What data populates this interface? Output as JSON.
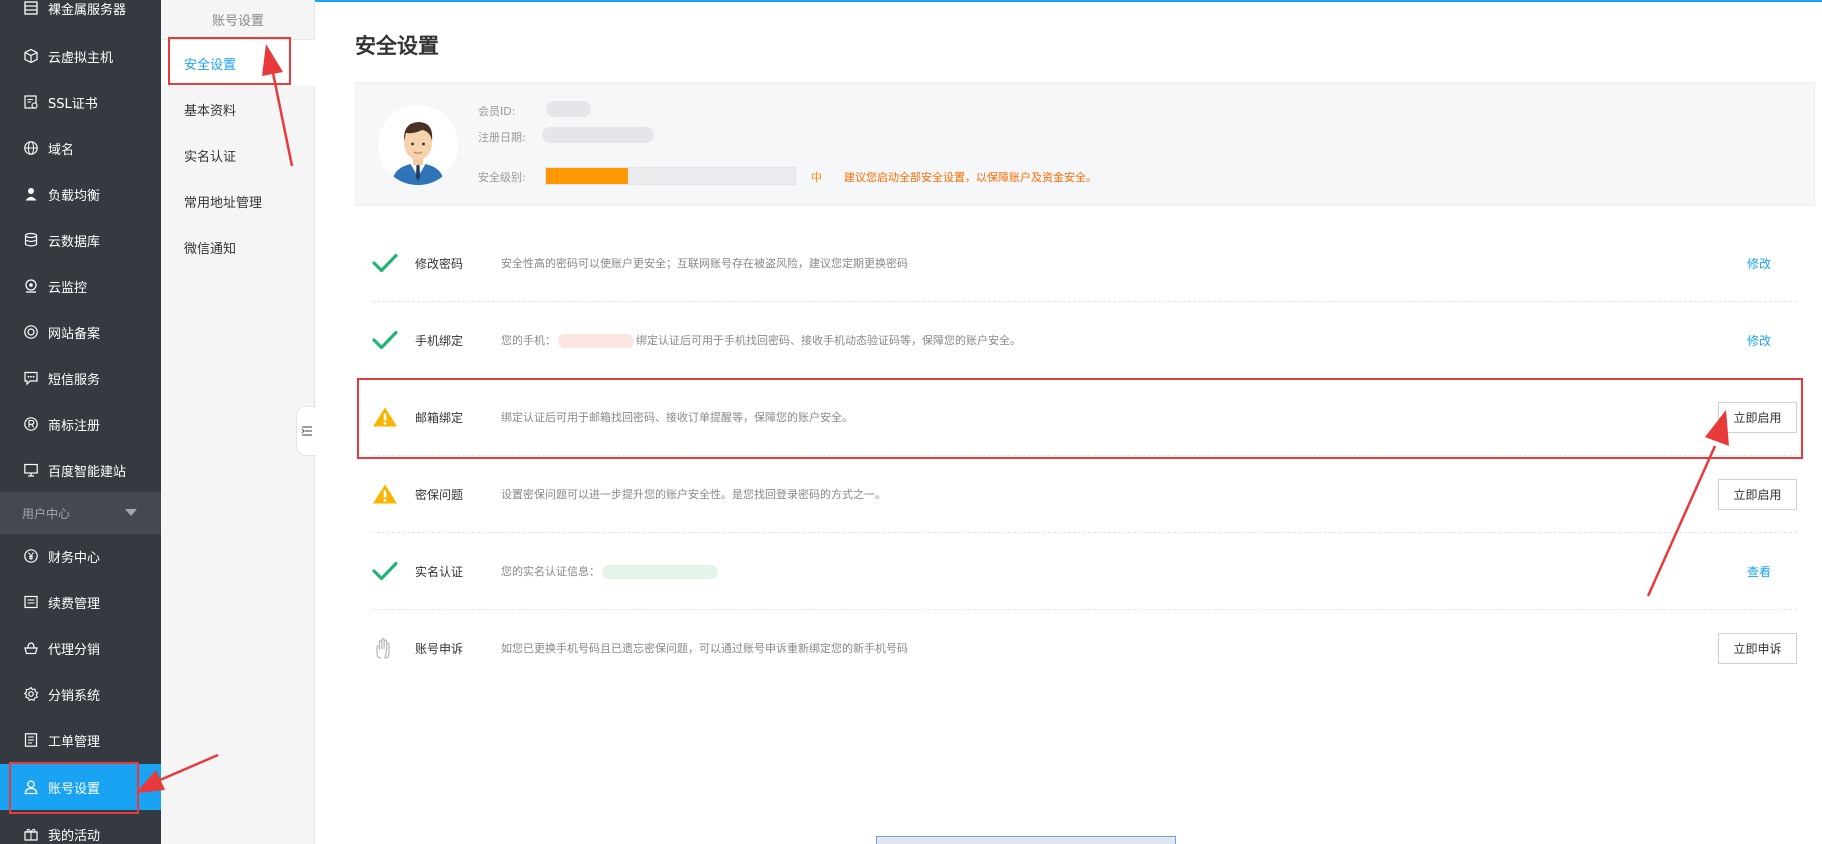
{
  "sidebar": {
    "items": [
      {
        "label": "裸金属服务器",
        "icon": "server-icon"
      },
      {
        "label": "云虚拟主机",
        "icon": "cube-icon"
      },
      {
        "label": "SSL证书",
        "icon": "certificate-icon"
      },
      {
        "label": "域名",
        "icon": "globe-icon"
      },
      {
        "label": "负载均衡",
        "icon": "balance-icon"
      },
      {
        "label": "云数据库",
        "icon": "database-icon"
      },
      {
        "label": "云监控",
        "icon": "monitor-icon"
      },
      {
        "label": "网站备案",
        "icon": "record-icon"
      },
      {
        "label": "短信服务",
        "icon": "sms-icon"
      },
      {
        "label": "商标注册",
        "icon": "trademark-icon"
      },
      {
        "label": "百度智能建站",
        "icon": "desktop-icon"
      }
    ],
    "section_label": "用户中心",
    "user_items": [
      {
        "label": "财务中心",
        "icon": "yen-icon"
      },
      {
        "label": "续费管理",
        "icon": "renew-icon"
      },
      {
        "label": "代理分销",
        "icon": "agent-icon"
      },
      {
        "label": "分销系统",
        "icon": "gear-icon"
      },
      {
        "label": "工单管理",
        "icon": "ticket-icon"
      },
      {
        "label": "账号设置",
        "icon": "user-icon"
      },
      {
        "label": "我的活动",
        "icon": "gift-icon"
      }
    ],
    "accent": "#1aa3f3"
  },
  "subnav": {
    "title": "账号设置",
    "items": [
      "安全设置",
      "基本资料",
      "实名认证",
      "常用地址管理",
      "微信通知"
    ]
  },
  "main": {
    "title": "安全设置",
    "profile": {
      "member_id_label": "会员ID:",
      "reg_date_label": "注册日期:",
      "level_label": "安全级别:",
      "level_text": "中",
      "level_progress": 0.33,
      "level_hint": "建议您启动全部安全设置，以保障账户及资金安全。"
    },
    "rows": [
      {
        "status": "check-icon",
        "name": "修改密码",
        "desc": "安全性高的密码可以使账户更安全；互联网账号存在被盗风险，建议您定期更换密码",
        "action": "修改",
        "action_type": "link"
      },
      {
        "status": "check-icon",
        "name": "手机绑定",
        "desc_pre": "您的手机：",
        "desc": "绑定认证后可用于手机找回密码、接收手机动态验证码等，保障您的账户安全。",
        "action": "修改",
        "action_type": "link"
      },
      {
        "status": "warning-icon",
        "name": "邮箱绑定",
        "desc": "绑定认证后可用于邮箱找回密码、接收订单提醒等，保障您的账户安全。",
        "action": "立即启用",
        "action_type": "button"
      },
      {
        "status": "warning-icon",
        "name": "密保问题",
        "desc": "设置密保问题可以进一步提升您的账户安全性。是您找回登录密码的方式之一。",
        "action": "立即启用",
        "action_type": "button"
      },
      {
        "status": "check-icon",
        "name": "实名认证",
        "desc_pre": "您的实名认证信息：",
        "desc": "",
        "action": "查看",
        "action_type": "link"
      },
      {
        "status": "hand-icon",
        "name": "账号申诉",
        "desc": "如您已更换手机号码且已遗忘密保问题，可以通过账号申诉重新绑定您的新手机号码",
        "action": "立即申诉",
        "action_type": "button"
      }
    ],
    "colors": {
      "check": "#21b573",
      "warning": "#f8b400",
      "orange": "#ff9900",
      "annotation": "#e83a3a"
    }
  }
}
